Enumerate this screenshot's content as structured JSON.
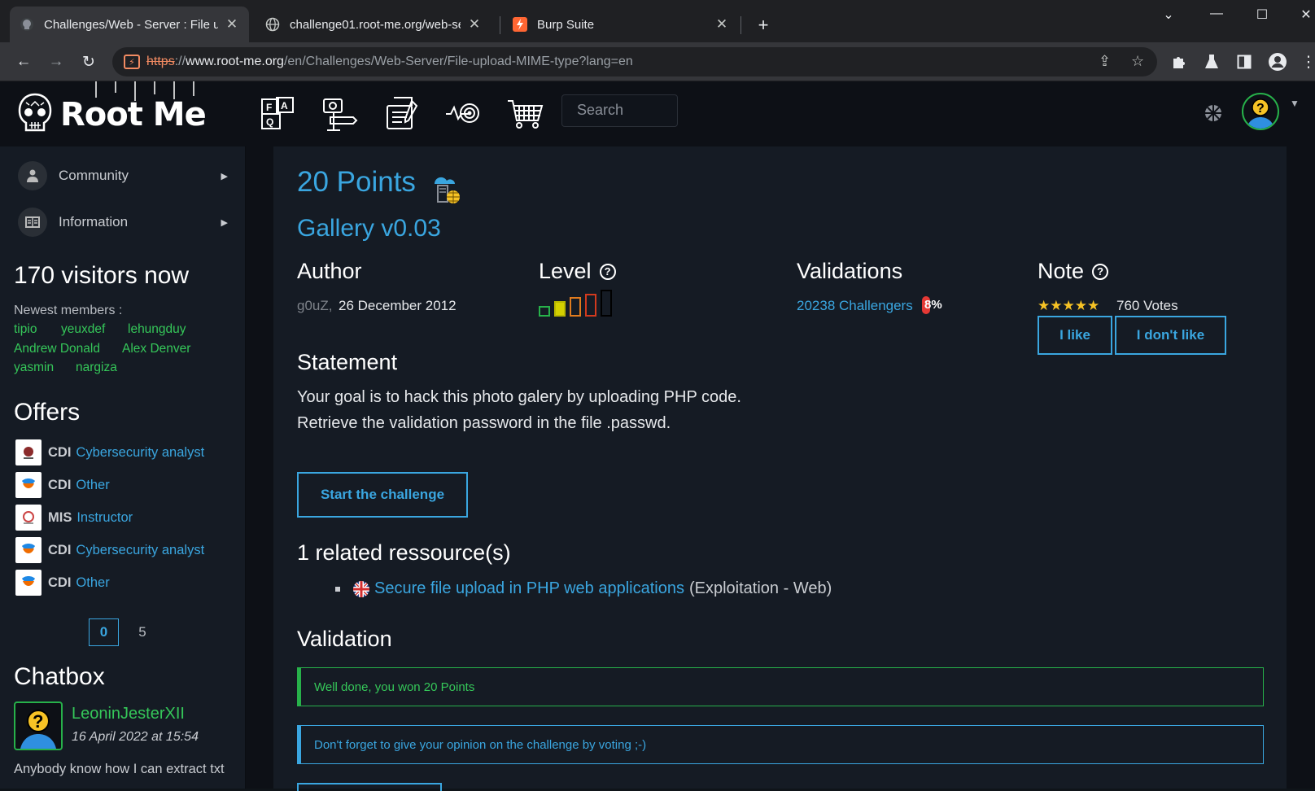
{
  "browser": {
    "tabs": [
      {
        "title": "Challenges/Web - Server : File up",
        "close": "✕"
      },
      {
        "title": "challenge01.root-me.org/web-se",
        "close": "✕"
      },
      {
        "title": "Burp Suite",
        "close": "✕"
      }
    ],
    "new_tab": "+",
    "url_scheme": "https",
    "url_sep": "://",
    "url_host": "www.root-me.org",
    "url_path": "/en/Challenges/Web-Server/File-upload-MIME-type?lang=en"
  },
  "header": {
    "logo_text": "Root Me",
    "search_placeholder": "Search"
  },
  "sidebar": {
    "menu": [
      {
        "label": "Community"
      },
      {
        "label": "Information"
      }
    ],
    "visitors": "170 visitors now",
    "newest_label": "Newest members :",
    "members": [
      "tipio",
      "yeuxdef",
      "lehungduy",
      "Andrew Donald",
      "Alex Denver",
      "yasmin",
      "nargiza"
    ],
    "offers_title": "Offers",
    "offers": [
      {
        "type": "CDI",
        "title": "Cybersecurity analyst"
      },
      {
        "type": "CDI",
        "title": "Other"
      },
      {
        "type": "MIS",
        "title": "Instructor"
      },
      {
        "type": "CDI",
        "title": "Cybersecurity analyst"
      },
      {
        "type": "CDI",
        "title": "Other"
      }
    ],
    "pager": {
      "current": "0",
      "next": "5"
    },
    "chatbox_title": "Chatbox",
    "chat": {
      "user": "LeoninJesterXII",
      "date": "16 April 2022 at 15:54",
      "message": "Anybody know how I can extract txt"
    }
  },
  "challenge": {
    "points": "20 Points",
    "name": "Gallery v0.03",
    "author_h": "Author",
    "author_nick": "g0uZ,",
    "author_date": "26 December 2012",
    "level_h": "Level",
    "level": 2,
    "level_max": 5,
    "validations_h": "Validations",
    "validations_link": "20238 Challengers",
    "validations_pct": "8%",
    "note_h": "Note",
    "stars": "★★★★★",
    "votes": "760 Votes",
    "like": "I like",
    "dislike": "I don't like",
    "statement_h": "Statement",
    "statement_1": "Your goal is to hack this photo galery by uploading PHP code.",
    "statement_2": "Retrieve the validation password in the file .passwd.",
    "start_btn": "Start the challenge",
    "related_h": "1 related ressource(s)",
    "resource_link": "Secure file upload in PHP web applications",
    "resource_cat": "(Exploitation - Web)",
    "validation_h": "Validation",
    "alert_ok": "Well done, you won 20 Points",
    "alert_info": "Don't forget to give your opinion on the challenge by voting ;-)"
  },
  "colors": {
    "accent": "#3aa6e0",
    "success": "#35c759",
    "bg": "#151b24"
  }
}
